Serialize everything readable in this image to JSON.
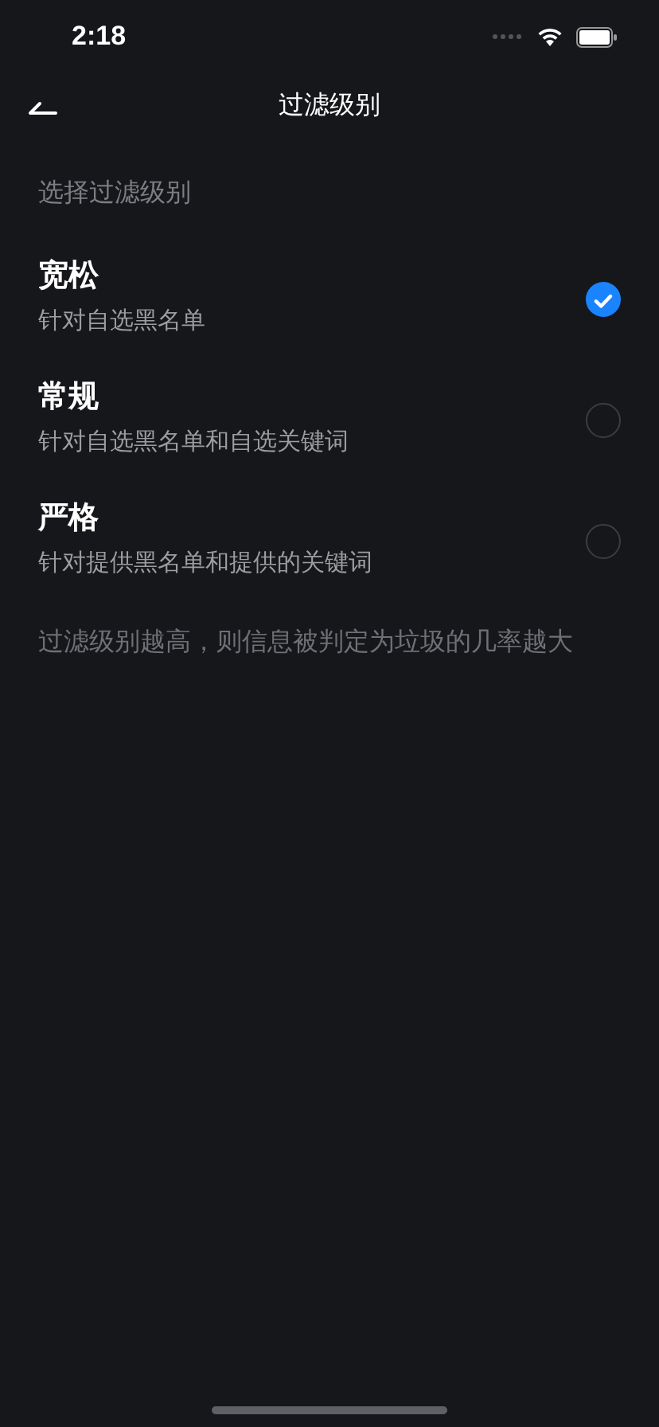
{
  "status_bar": {
    "time": "2:18"
  },
  "nav": {
    "title": "过滤级别"
  },
  "section_label": "选择过滤级别",
  "options": [
    {
      "title": "宽松",
      "subtitle": "针对自选黑名单",
      "selected": true
    },
    {
      "title": "常规",
      "subtitle": "针对自选黑名单和自选关键词",
      "selected": false
    },
    {
      "title": "严格",
      "subtitle": "针对提供黑名单和提供的关键词",
      "selected": false
    }
  ],
  "note": "过滤级别越高，则信息被判定为垃圾的几率越大"
}
